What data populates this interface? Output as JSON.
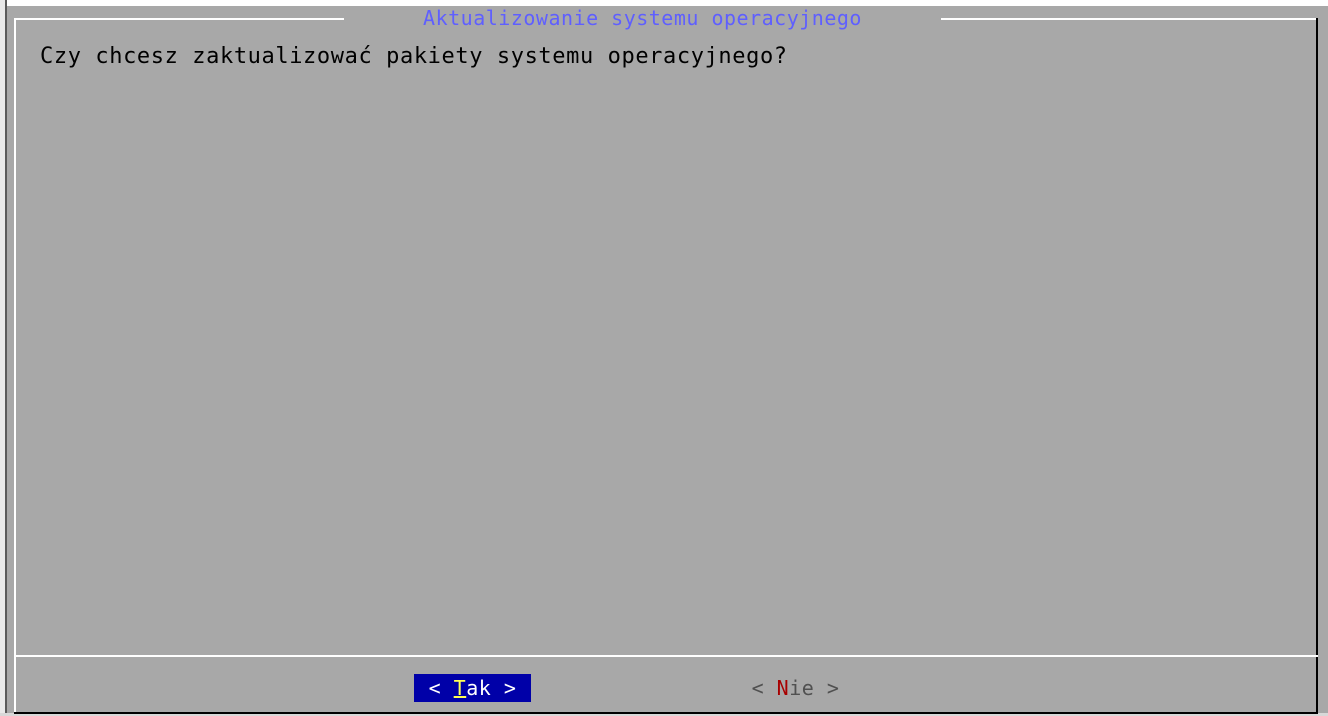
{
  "dialog": {
    "title": "Aktualizowanie systemu operacyjnego",
    "question": "Czy chcesz zaktualizować pakiety systemu operacyjnego?"
  },
  "buttons": {
    "yes": {
      "left": "< ",
      "hotkey": "T",
      "rest": "ak",
      "right": " >"
    },
    "no": {
      "left": "< ",
      "hotkey": "N",
      "rest": "ie",
      "right": " >"
    }
  },
  "colors": {
    "background": "#a8a8a8",
    "title": "#5f5fff",
    "selected_button_bg": "#0000a8",
    "selected_hotkey": "#ffff54",
    "unselected_hotkey": "#a80000"
  }
}
